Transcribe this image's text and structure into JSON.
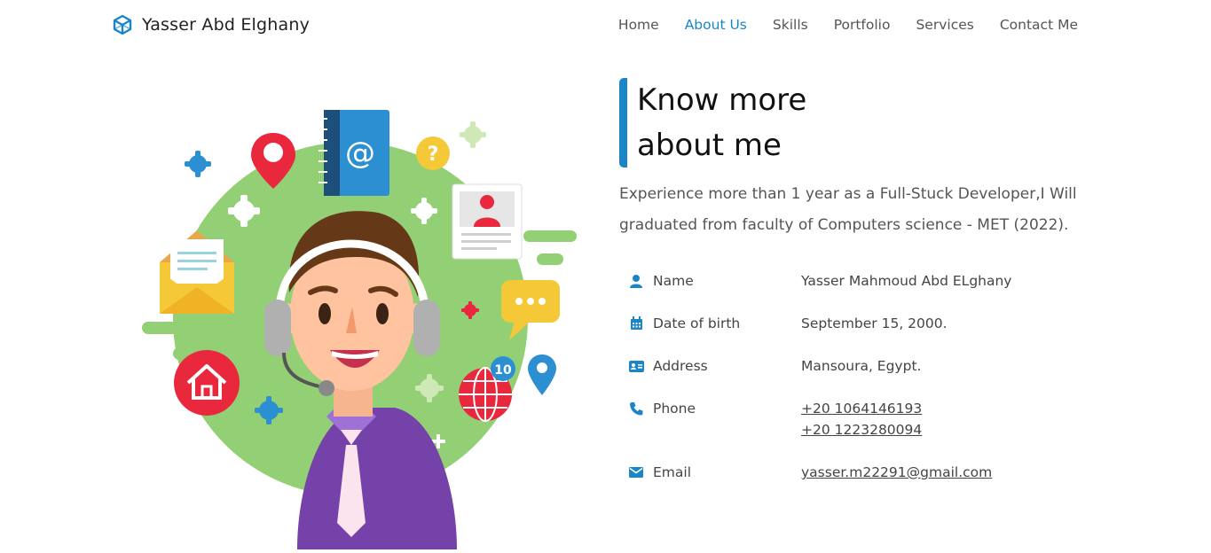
{
  "brand": {
    "name": "Yasser Abd Elghany",
    "icon": "codepen-cube-icon"
  },
  "nav": {
    "items": [
      {
        "label": "Home",
        "active": false
      },
      {
        "label": "About Us",
        "active": true
      },
      {
        "label": "Skills",
        "active": false
      },
      {
        "label": "Portfolio",
        "active": false
      },
      {
        "label": "Services",
        "active": false
      },
      {
        "label": "Contact Me",
        "active": false
      }
    ]
  },
  "about": {
    "title_line1": "Know more",
    "title_line2": "about me",
    "description": "Experience more than 1 year as a Full-Stuck Developer,I Will graduated from faculty of Computers science - MET (2022)."
  },
  "info": {
    "name": {
      "label": "Name",
      "value": "Yasser Mahmoud Abd ELghany",
      "icon": "user-icon"
    },
    "dob": {
      "label": "Date of birth",
      "value": "September 15, 2000.",
      "icon": "calendar-icon"
    },
    "address": {
      "label": "Address",
      "value": "Mansoura, Egypt.",
      "icon": "id-card-icon"
    },
    "phone": {
      "label": "Phone",
      "values": [
        "+20 1064146193",
        "+20 1223280094"
      ],
      "icon": "phone-icon"
    },
    "email": {
      "label": "Email",
      "value": "yasser.m22291@gmail.com",
      "icon": "envelope-icon"
    }
  },
  "illustration": {
    "badge_count": "10"
  },
  "colors": {
    "accent": "#1a85c7",
    "green": "#93cf74",
    "red": "#e9283d",
    "purple": "#7442a8"
  }
}
